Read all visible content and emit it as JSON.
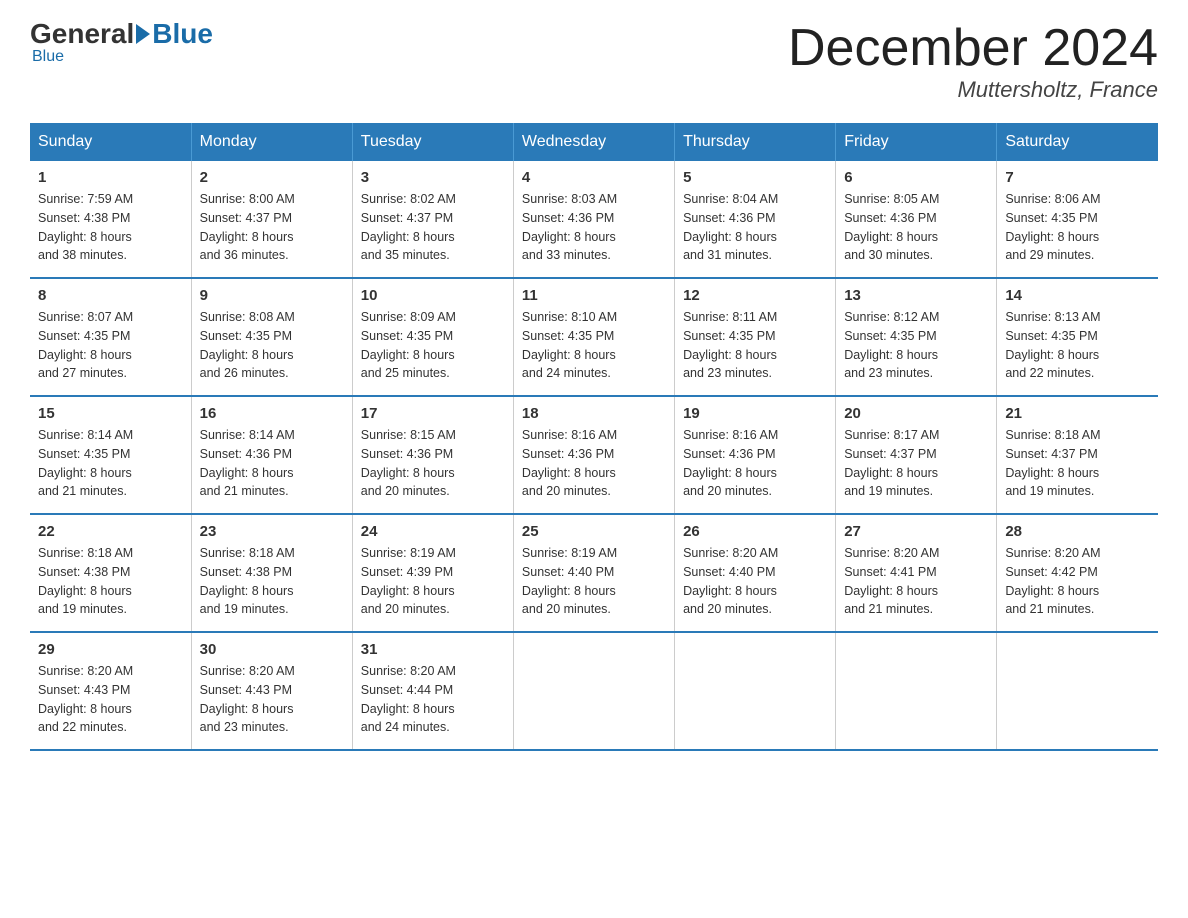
{
  "logo": {
    "general": "General",
    "blue": "Blue"
  },
  "title": "December 2024",
  "location": "Muttersholtz, France",
  "days_header": [
    "Sunday",
    "Monday",
    "Tuesday",
    "Wednesday",
    "Thursday",
    "Friday",
    "Saturday"
  ],
  "weeks": [
    [
      {
        "day": "1",
        "sunrise": "7:59 AM",
        "sunset": "4:38 PM",
        "daylight": "8 hours and 38 minutes."
      },
      {
        "day": "2",
        "sunrise": "8:00 AM",
        "sunset": "4:37 PM",
        "daylight": "8 hours and 36 minutes."
      },
      {
        "day": "3",
        "sunrise": "8:02 AM",
        "sunset": "4:37 PM",
        "daylight": "8 hours and 35 minutes."
      },
      {
        "day": "4",
        "sunrise": "8:03 AM",
        "sunset": "4:36 PM",
        "daylight": "8 hours and 33 minutes."
      },
      {
        "day": "5",
        "sunrise": "8:04 AM",
        "sunset": "4:36 PM",
        "daylight": "8 hours and 31 minutes."
      },
      {
        "day": "6",
        "sunrise": "8:05 AM",
        "sunset": "4:36 PM",
        "daylight": "8 hours and 30 minutes."
      },
      {
        "day": "7",
        "sunrise": "8:06 AM",
        "sunset": "4:35 PM",
        "daylight": "8 hours and 29 minutes."
      }
    ],
    [
      {
        "day": "8",
        "sunrise": "8:07 AM",
        "sunset": "4:35 PM",
        "daylight": "8 hours and 27 minutes."
      },
      {
        "day": "9",
        "sunrise": "8:08 AM",
        "sunset": "4:35 PM",
        "daylight": "8 hours and 26 minutes."
      },
      {
        "day": "10",
        "sunrise": "8:09 AM",
        "sunset": "4:35 PM",
        "daylight": "8 hours and 25 minutes."
      },
      {
        "day": "11",
        "sunrise": "8:10 AM",
        "sunset": "4:35 PM",
        "daylight": "8 hours and 24 minutes."
      },
      {
        "day": "12",
        "sunrise": "8:11 AM",
        "sunset": "4:35 PM",
        "daylight": "8 hours and 23 minutes."
      },
      {
        "day": "13",
        "sunrise": "8:12 AM",
        "sunset": "4:35 PM",
        "daylight": "8 hours and 23 minutes."
      },
      {
        "day": "14",
        "sunrise": "8:13 AM",
        "sunset": "4:35 PM",
        "daylight": "8 hours and 22 minutes."
      }
    ],
    [
      {
        "day": "15",
        "sunrise": "8:14 AM",
        "sunset": "4:35 PM",
        "daylight": "8 hours and 21 minutes."
      },
      {
        "day": "16",
        "sunrise": "8:14 AM",
        "sunset": "4:36 PM",
        "daylight": "8 hours and 21 minutes."
      },
      {
        "day": "17",
        "sunrise": "8:15 AM",
        "sunset": "4:36 PM",
        "daylight": "8 hours and 20 minutes."
      },
      {
        "day": "18",
        "sunrise": "8:16 AM",
        "sunset": "4:36 PM",
        "daylight": "8 hours and 20 minutes."
      },
      {
        "day": "19",
        "sunrise": "8:16 AM",
        "sunset": "4:36 PM",
        "daylight": "8 hours and 20 minutes."
      },
      {
        "day": "20",
        "sunrise": "8:17 AM",
        "sunset": "4:37 PM",
        "daylight": "8 hours and 19 minutes."
      },
      {
        "day": "21",
        "sunrise": "8:18 AM",
        "sunset": "4:37 PM",
        "daylight": "8 hours and 19 minutes."
      }
    ],
    [
      {
        "day": "22",
        "sunrise": "8:18 AM",
        "sunset": "4:38 PM",
        "daylight": "8 hours and 19 minutes."
      },
      {
        "day": "23",
        "sunrise": "8:18 AM",
        "sunset": "4:38 PM",
        "daylight": "8 hours and 19 minutes."
      },
      {
        "day": "24",
        "sunrise": "8:19 AM",
        "sunset": "4:39 PM",
        "daylight": "8 hours and 20 minutes."
      },
      {
        "day": "25",
        "sunrise": "8:19 AM",
        "sunset": "4:40 PM",
        "daylight": "8 hours and 20 minutes."
      },
      {
        "day": "26",
        "sunrise": "8:20 AM",
        "sunset": "4:40 PM",
        "daylight": "8 hours and 20 minutes."
      },
      {
        "day": "27",
        "sunrise": "8:20 AM",
        "sunset": "4:41 PM",
        "daylight": "8 hours and 21 minutes."
      },
      {
        "day": "28",
        "sunrise": "8:20 AM",
        "sunset": "4:42 PM",
        "daylight": "8 hours and 21 minutes."
      }
    ],
    [
      {
        "day": "29",
        "sunrise": "8:20 AM",
        "sunset": "4:43 PM",
        "daylight": "8 hours and 22 minutes."
      },
      {
        "day": "30",
        "sunrise": "8:20 AM",
        "sunset": "4:43 PM",
        "daylight": "8 hours and 23 minutes."
      },
      {
        "day": "31",
        "sunrise": "8:20 AM",
        "sunset": "4:44 PM",
        "daylight": "8 hours and 24 minutes."
      },
      {
        "day": "",
        "sunrise": "",
        "sunset": "",
        "daylight": ""
      },
      {
        "day": "",
        "sunrise": "",
        "sunset": "",
        "daylight": ""
      },
      {
        "day": "",
        "sunrise": "",
        "sunset": "",
        "daylight": ""
      },
      {
        "day": "",
        "sunrise": "",
        "sunset": "",
        "daylight": ""
      }
    ]
  ],
  "labels": {
    "sunrise": "Sunrise:",
    "sunset": "Sunset:",
    "daylight": "Daylight:"
  }
}
